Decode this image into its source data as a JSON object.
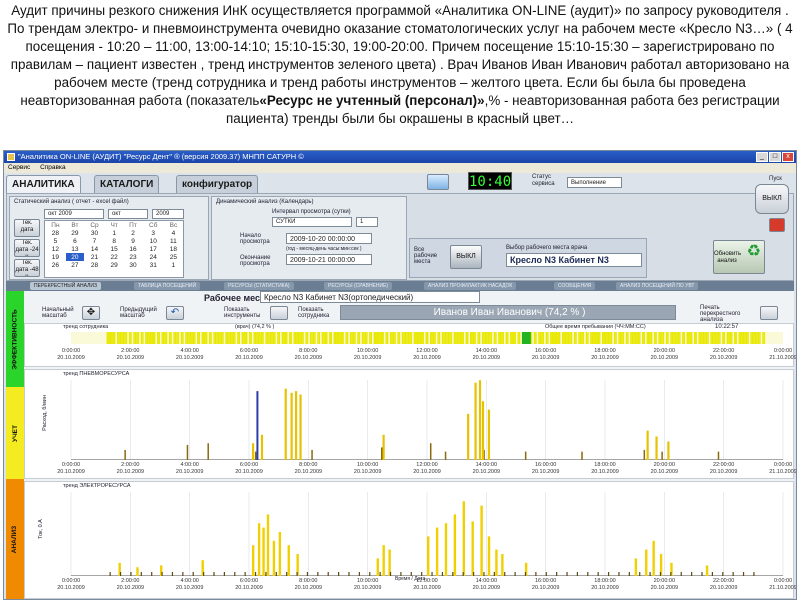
{
  "caption": {
    "part1": "Аудит причины резкого снижения ИнК осуществляется программой «Аналитика ON-LINE (аудит)» по запросу руководителя . По трендам электро- и пневмоинструмента очевидно оказание стоматологических услуг на рабочем месте «Кресло N3…» ( 4 посещения - 10:20 – 11:00, 13:00-14:10; 15:10-15:30, 19:00-20:00. Причем посещение 15:10-15:30 – зарегистрировано по правилам – пациент известен , тренд инструментов зеленого цвета) . Врач Иванов Иван Иванович работал авторизовано на рабочем месте (тренд сотрудника и тренд работы инструментов – желтого цвета. Если бы была бы проведена неавторизованная работа (показатель",
    "bold": "«Ресурс не учтенный (персонал)»",
    "part2": ",% - неавторизованная работа без регистрации пациента) тренды были бы окрашены в красный цвет…"
  },
  "window": {
    "title": "\"Аналитика ON-LINE (АУДИТ) \"Ресурс Дент\" ® (версия 2009.37)   МНПП САТУРН ©",
    "min": "_",
    "max": "□",
    "close": "x",
    "menu": [
      "Сервис",
      "Справка"
    ]
  },
  "tabs": [
    "АНАЛИТИКА",
    "КАТАЛОГИ",
    "конфигуратор"
  ],
  "clock": "10:40",
  "status": {
    "label1": "Статус",
    "label2": "сервиса",
    "value": "Выполнение"
  },
  "static_analysis": {
    "title": "Статический анализ ( отчет - excel файл)",
    "btn_day": "Тек. дата",
    "btn_24": "Тек. дата -24 ч",
    "btn_48": "Тек. дата -48 ч",
    "month": "окт 2009",
    "month_short": "окт",
    "year": "2009",
    "week_header": [
      "Пн",
      "Вт",
      "Ср",
      "Чт",
      "Пт",
      "Сб",
      "Вс"
    ],
    "days": [
      [
        "28",
        "29",
        "30",
        "1",
        "2",
        "3",
        "4"
      ],
      [
        "5",
        "6",
        "7",
        "8",
        "9",
        "10",
        "11"
      ],
      [
        "12",
        "13",
        "14",
        "15",
        "16",
        "17",
        "18"
      ],
      [
        "19",
        "20",
        "21",
        "22",
        "23",
        "24",
        "25"
      ],
      [
        "26",
        "27",
        "28",
        "29",
        "30",
        "31",
        "1"
      ]
    ]
  },
  "dynamic_analysis": {
    "title": "Динамический анализ (Календарь)",
    "interval_label": "Интервал просмотра (сутки)",
    "interval_value": "СУТКИ",
    "interval_num": "1",
    "start_label": "Начало просмотра",
    "start_value": "2009-10-20 00:00:00",
    "format_hint": "(год - месяц-день часы:мин:сек )",
    "end_label": "Окончание просмотра",
    "end_value": "2009-10-21 00:00:00"
  },
  "workplace": {
    "all_label": "Все рабочие места",
    "vykl": "ВЫКЛ",
    "select_label": "Выбор рабочего места врача",
    "select_value": "Кресло N3  Кабинет N3",
    "refresh": "Обновить анализ"
  },
  "sound": {
    "label": "Пуск",
    "value": "ВЫКЛ"
  },
  "subtabs": [
    "ПЕРЕКРЕСТНЫЙ АНАЛИЗ",
    "ТАБЛИЦА ПОСЕЩЕНИЙ",
    "РЕСУРСЫ (СТАТИСТИКА)",
    "РЕСУРСЫ (СРАВНЕНИЕ)",
    "АНАЛИЗ ПРОФИЛАКТИК НАСАДОК",
    "СООБЩЕНИЯ",
    "АНАЛИЗ ПОСЕЩЕНИЙ ПО УВТ"
  ],
  "workspace": {
    "workplace_label": "Рабочее место",
    "workplace_value": "Кресло N3  Кабинет N3(ортопедический)",
    "initial_scale": "Начальный масштаб",
    "prev_scale": "Предыдущий масштаб",
    "show_tools": "Показать инструменты",
    "show_staff": "Показать сотрудника",
    "staff_value": "Иванов Иван Иванович (74,2 % )",
    "print": "Печать перекрестного анализа"
  },
  "trend1": {
    "label": "тренд сотрудника",
    "worker": "(врач) (74,2 % )",
    "total_label": "Общее время пребывания (ЧЧ:ММ:СС)",
    "total_value": "10:22:57"
  },
  "trend2": {
    "label": "тренд ПНЕВМОРЕСУРСА",
    "ylabel": "Расход, б/мин"
  },
  "trend3": {
    "label": "тренд ЭЛЕКТРОРЕСУРСА",
    "ylabel": "Ток, 0.A"
  },
  "xaxis": {
    "times": [
      "0:00:00",
      "2:00:00",
      "4:00:00",
      "6:00:00",
      "8:00:00",
      "10:00:00",
      "12:00:00",
      "14:00:00",
      "16:00:00",
      "18:00:00",
      "20:00:00",
      "22:00:00",
      "0:00:00"
    ],
    "dates": [
      "20.10.2009",
      "20.10.2009",
      "20.10.2009",
      "20.10.2009",
      "20.10.2009",
      "20.10.2009",
      "20.10.2009",
      "20.10.2009",
      "20.10.2009",
      "20.10.2009",
      "20.10.2009",
      "20.10.2009",
      "21.10.2009"
    ],
    "caption": "Время / Дата"
  },
  "side": [
    "ЭФФЕКТИВНОСТЬ",
    "УЧЕТ",
    "АНАЛИЗ"
  ],
  "colors": {
    "worker": "#e8e800",
    "pneumo": "#e6c200",
    "electro": "#f0d000",
    "blue": "#2b3fa8",
    "green": "#22b322",
    "orange": "#f08a00"
  }
}
